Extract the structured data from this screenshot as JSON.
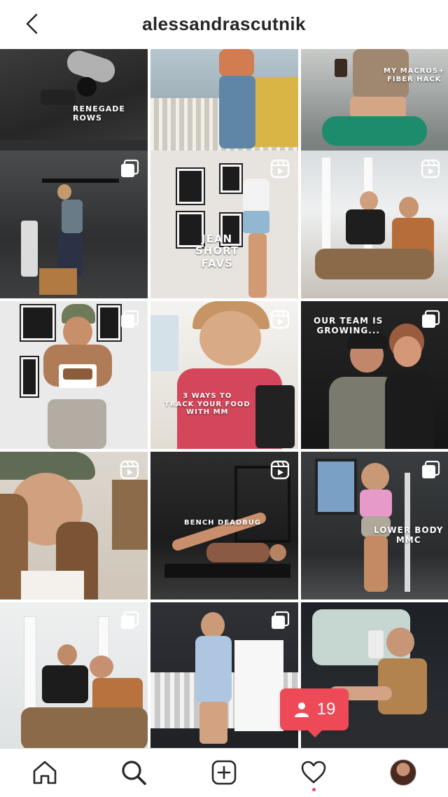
{
  "header": {
    "username": "alessandrascutnik",
    "back_icon": "chevron-left-icon"
  },
  "posts": [
    {
      "kind": "image",
      "overlay": "RENEGADE ROWS",
      "badge": ""
    },
    {
      "kind": "image",
      "overlay": "",
      "badge": ""
    },
    {
      "kind": "image",
      "overlay": "MY MACROS+\nFIBER HACK",
      "badge": ""
    },
    {
      "kind": "carousel",
      "overlay": "",
      "badge": "carousel-icon"
    },
    {
      "kind": "reel",
      "overlay": "JEAN\nSHORT\nFAVS",
      "badge": "reels-icon"
    },
    {
      "kind": "reel",
      "overlay": "",
      "badge": "reels-icon"
    },
    {
      "kind": "carousel",
      "overlay": "",
      "badge": "carousel-icon"
    },
    {
      "kind": "reel",
      "overlay": "3 WAYS TO\nTRACK YOUR FOOD\nWITH MM",
      "badge": "reels-icon"
    },
    {
      "kind": "carousel",
      "overlay": "OUR TEAM IS\nGROWING...",
      "badge": "carousel-icon"
    },
    {
      "kind": "reel",
      "overlay": "",
      "badge": "reels-icon"
    },
    {
      "kind": "reel",
      "overlay": "BENCH DEADBUG",
      "badge": "reels-icon"
    },
    {
      "kind": "carousel",
      "overlay": "LOWER BODY\nMMC",
      "badge": "carousel-icon"
    },
    {
      "kind": "carousel",
      "overlay": "",
      "badge": "carousel-icon"
    },
    {
      "kind": "carousel",
      "overlay": "",
      "badge": "carousel-icon"
    },
    {
      "kind": "image",
      "overlay": "",
      "badge": ""
    }
  ],
  "notification": {
    "icon": "person-icon",
    "count": "19",
    "color": "#ed4956"
  },
  "tabs": [
    {
      "name": "home",
      "icon": "home-icon"
    },
    {
      "name": "search",
      "icon": "search-icon"
    },
    {
      "name": "create",
      "icon": "plus-square-icon"
    },
    {
      "name": "activity",
      "icon": "heart-icon"
    },
    {
      "name": "profile",
      "icon": "profile-avatar"
    }
  ],
  "colors": {
    "accent": "#ed4956",
    "text": "#262626",
    "divider": "#dbdbdb"
  }
}
